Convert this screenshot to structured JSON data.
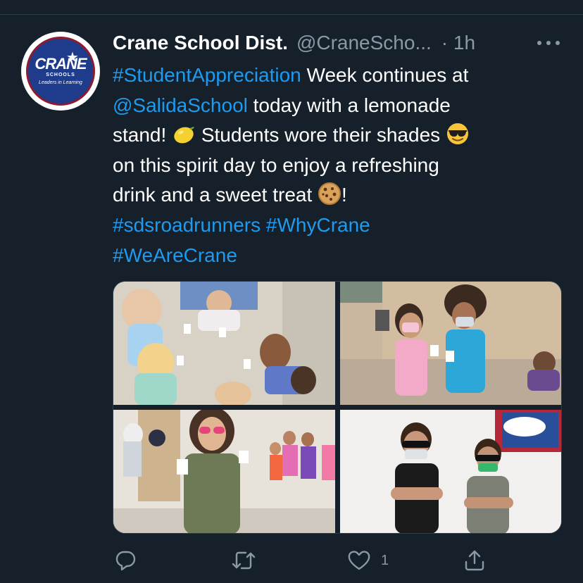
{
  "tweet": {
    "author": {
      "display_name": "Crane School Dist.",
      "handle": "@CraneScho...",
      "avatar": {
        "logo_text": "CRANE",
        "logo_sub": "SCHOOLS",
        "logo_tagline": "Leaders in Learning"
      }
    },
    "time": "· 1h",
    "text": {
      "line1_hashtag": "#StudentAppreciation",
      "line1_rest": " Week continues at",
      "line2_mention": "@SalidaSchool",
      "line2_rest": " today with a lemonade",
      "line3_a": "stand! ",
      "line3_b": " Students wore their shades ",
      "line4": "on this spirit day to enjoy a refreshing",
      "line5_a": "drink and a sweet treat ",
      "line5_b": "!",
      "line6_hashtag1": "#sdsroadrunners",
      "line6_hashtag2": "#WhyCrane",
      "line7_hashtag": "#WeAreCrane"
    },
    "emojis": [
      "lemon-emoji",
      "sunglasses-emoji",
      "cookie-emoji"
    ],
    "media": [
      {
        "name": "photo-students-sitting-with-cups"
      },
      {
        "name": "photo-two-girls-with-sunglasses"
      },
      {
        "name": "photo-teacher-team-crane-shirt"
      },
      {
        "name": "photo-two-boys-sunglasses-arms-crossed"
      }
    ],
    "actions": {
      "reply_icon": "reply-icon",
      "retweet_icon": "retweet-icon",
      "like_icon": "heart-icon",
      "like_count": "1",
      "share_icon": "share-icon"
    }
  },
  "colors": {
    "background": "#15202b",
    "link": "#1d9bf0",
    "secondary_text": "#8b98a5"
  }
}
